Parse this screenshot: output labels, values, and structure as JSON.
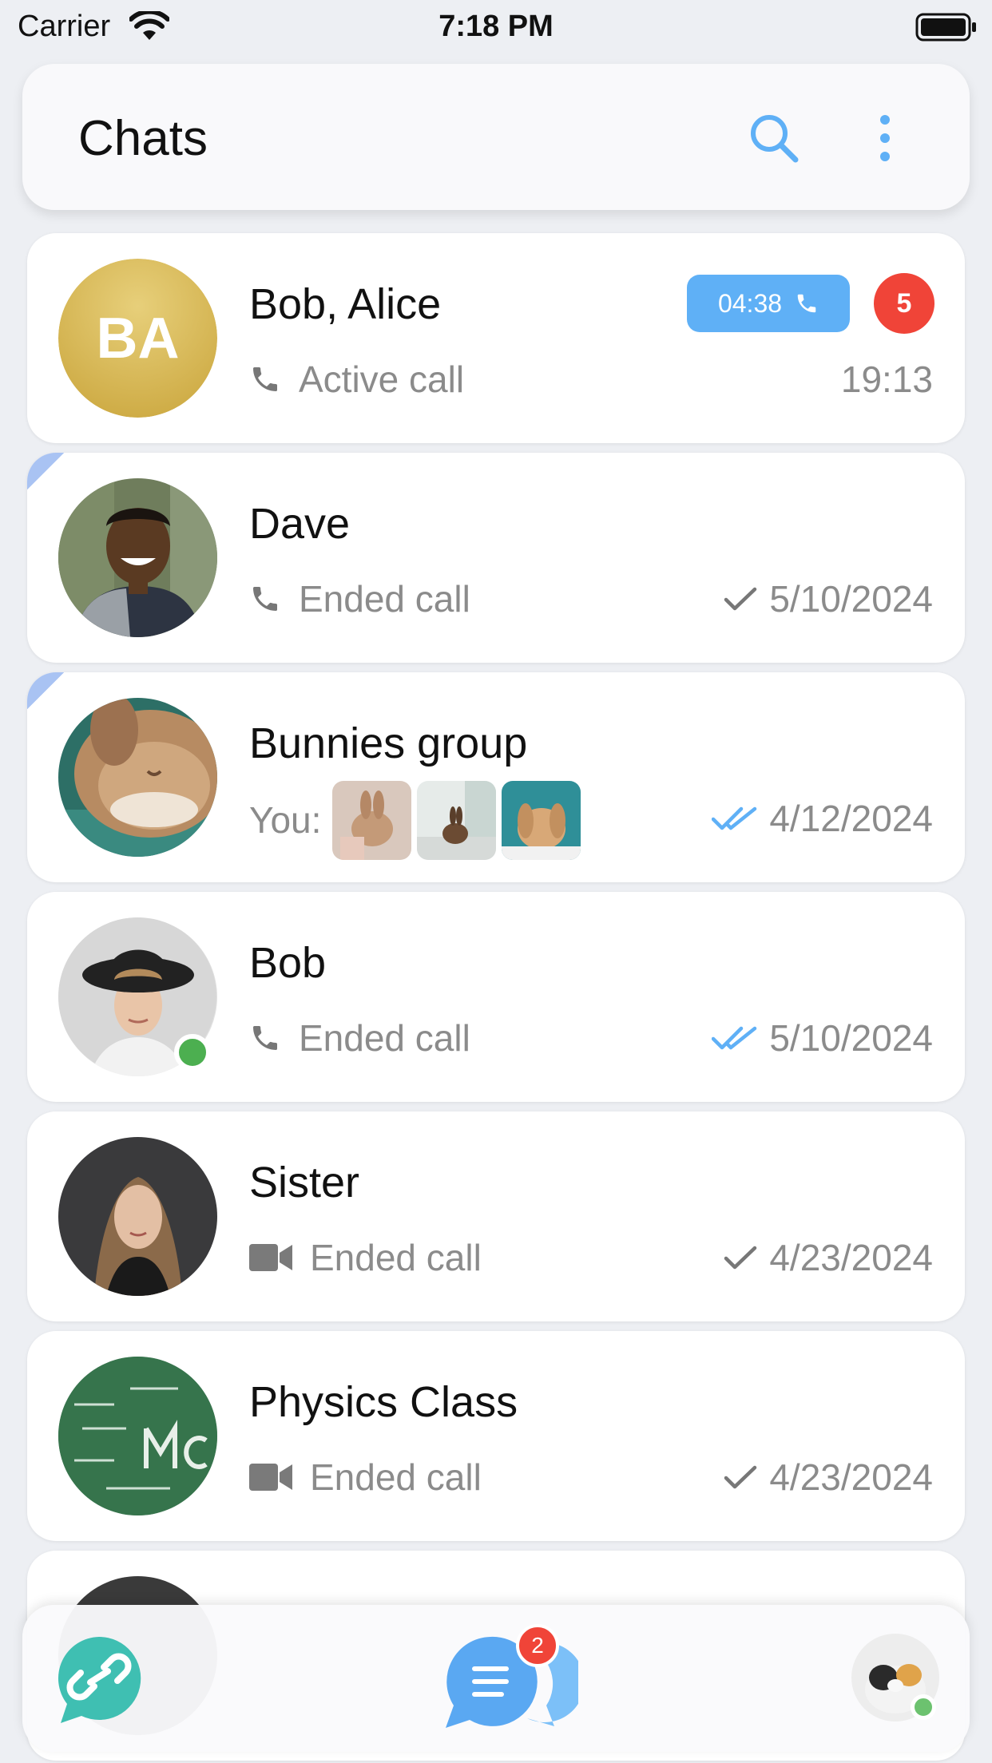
{
  "status_bar": {
    "carrier": "Carrier",
    "time": "7:18 PM"
  },
  "header": {
    "title": "Chats"
  },
  "colors": {
    "accent": "#5fb0f6",
    "badge": "#f04438",
    "online": "#4caf50"
  },
  "chats": [
    {
      "name": "Bob, Alice",
      "initials": "BA",
      "subtitle": "Active call",
      "date": "19:13",
      "call_timer": "04:38",
      "unread": "5",
      "subtitle_icon": "phone-icon"
    },
    {
      "name": "Dave",
      "subtitle": "Ended call",
      "date": "5/10/2024",
      "subtitle_icon": "phone-icon",
      "status": "sent-check-icon"
    },
    {
      "name": "Bunnies group",
      "subtitle": "You:",
      "date": "4/12/2024",
      "status": "read-double-check-icon"
    },
    {
      "name": "Bob",
      "subtitle": "Ended call",
      "date": "5/10/2024",
      "subtitle_icon": "phone-icon",
      "status": "read-double-check-icon"
    },
    {
      "name": "Sister",
      "subtitle": "Ended call",
      "date": "4/23/2024",
      "subtitle_icon": "video-camera-icon",
      "status": "sent-check-icon"
    },
    {
      "name": "Physics Class",
      "subtitle": "Ended call",
      "date": "4/23/2024",
      "subtitle_icon": "video-camera-icon",
      "status": "sent-check-icon"
    }
  ],
  "bottom_bar": {
    "chats_badge": "2"
  }
}
